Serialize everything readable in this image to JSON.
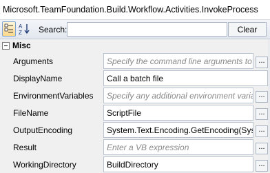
{
  "title": "Microsoft.TeamFoundation.Build.Workflow.Activities.InvokeProcess",
  "toolbar": {
    "search_label": "Search:",
    "search_value": "",
    "clear_label": "Clear",
    "categorized_icon": "categorized-view-icon",
    "alphabetical_icon": "alphabetical-sort-icon"
  },
  "category": {
    "label": "Misc",
    "expanded": true
  },
  "properties": [
    {
      "name": "Arguments",
      "value": "Specify the command line arguments to",
      "placeholder": true
    },
    {
      "name": "DisplayName",
      "value": "Call a batch file",
      "placeholder": false
    },
    {
      "name": "EnvironmentVariables",
      "value": "Specify any additional environment varia",
      "placeholder": true
    },
    {
      "name": "FileName",
      "value": "ScriptFile",
      "placeholder": false
    },
    {
      "name": "OutputEncoding",
      "value": "System.Text.Encoding.GetEncoding(Syst",
      "placeholder": false
    },
    {
      "name": "Result",
      "value": "Enter a VB expression",
      "placeholder": true
    },
    {
      "name": "WorkingDirectory",
      "value": "BuildDirectory",
      "placeholder": false
    }
  ],
  "ellipsis_label": "...",
  "colors": {
    "grid_background": "#f0f0f0",
    "value_border": "#b9c2cf",
    "placeholder_text": "#8a8a8a",
    "button_highlight": "#ffd88a"
  }
}
